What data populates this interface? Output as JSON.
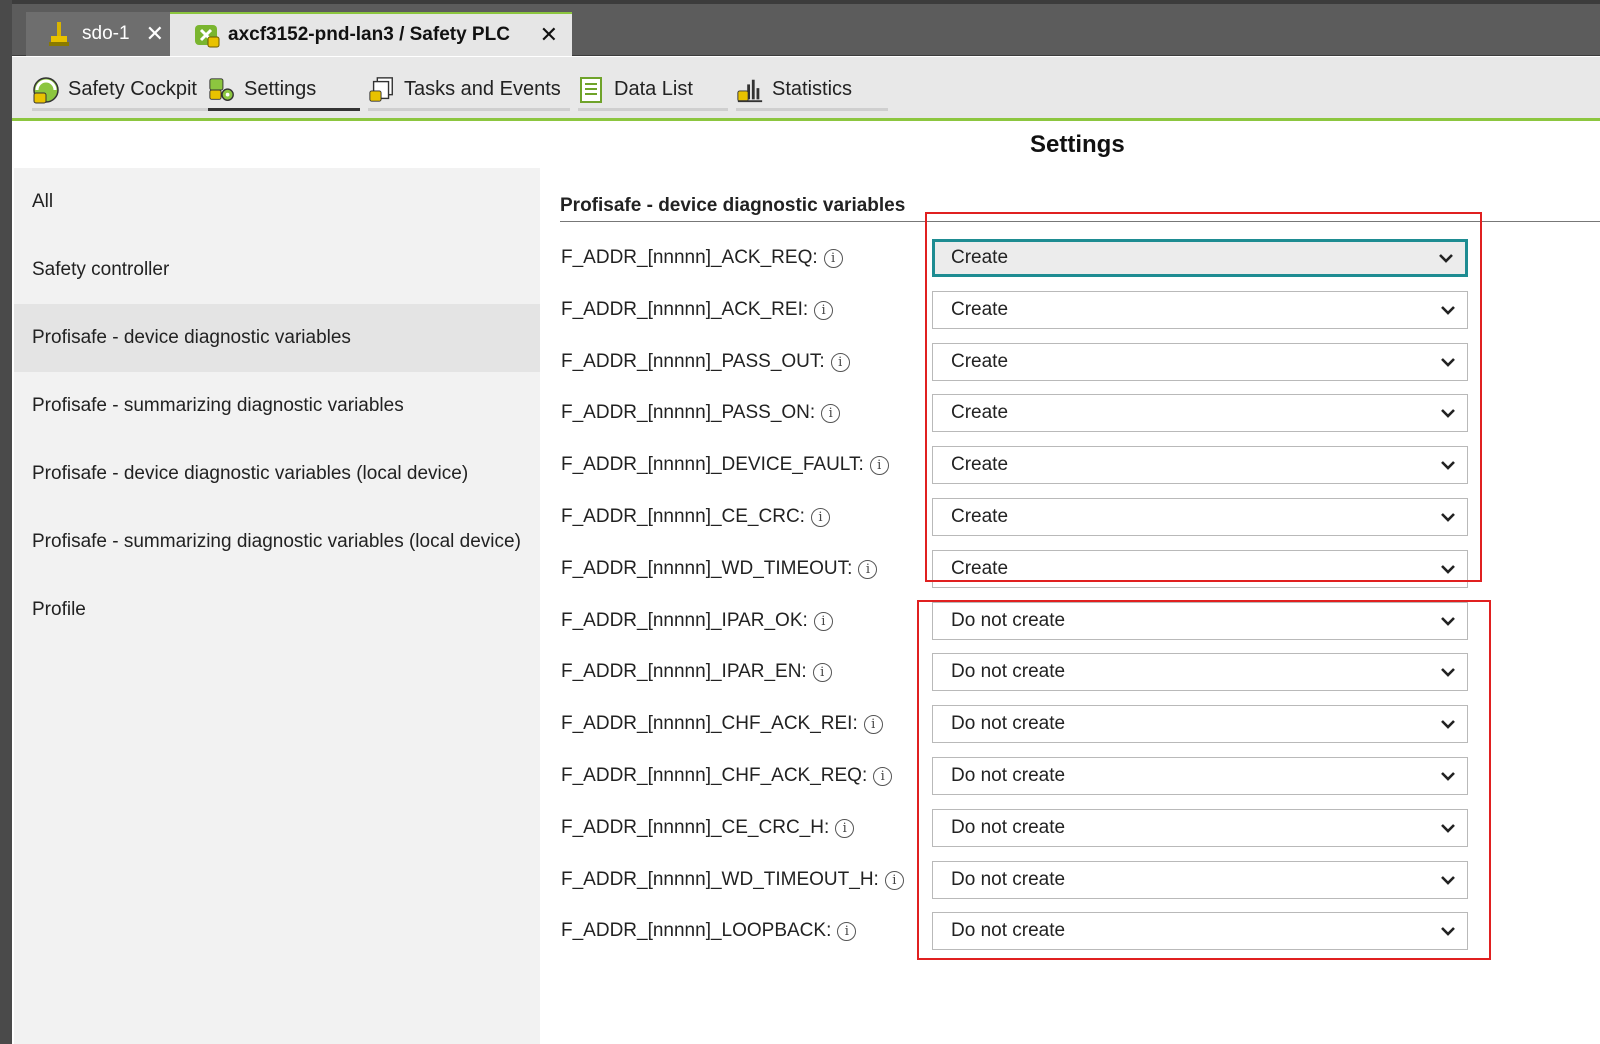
{
  "document_tabs": [
    {
      "label": "sdo-1",
      "icon": "sdo-device-icon",
      "close": "✕"
    },
    {
      "label": "axcf3152-pnd-lan3 / Safety PLC",
      "icon": "safety-plc-icon",
      "close": "✕"
    }
  ],
  "editor_tabs": [
    {
      "label": "Safety Cockpit",
      "icon": "cockpit-icon"
    },
    {
      "label": "Settings",
      "icon": "settings-gear-icon",
      "selected": true
    },
    {
      "label": "Tasks and Events",
      "icon": "tasks-icon"
    },
    {
      "label": "Data List",
      "icon": "list-icon"
    },
    {
      "label": "Statistics",
      "icon": "bar-chart-icon"
    }
  ],
  "page_title": "Settings",
  "sidebar": {
    "items": [
      {
        "label": "All"
      },
      {
        "label": "Safety controller"
      },
      {
        "label": "Profisafe - device diagnostic variables",
        "selected": true
      },
      {
        "label": "Profisafe - summarizing diagnostic variables"
      },
      {
        "label": "Profisafe - device diagnostic variables (local device)"
      },
      {
        "label": "Profisafe - summarizing diagnostic variables (local device)"
      },
      {
        "label": "Profile"
      }
    ]
  },
  "section": {
    "title": "Profisafe - device diagnostic variables",
    "info_glyph": "i",
    "rows": [
      {
        "label": "F_ADDR_[nnnnn]_ACK_REQ:",
        "value": "Create",
        "focused": true
      },
      {
        "label": "F_ADDR_[nnnnn]_ACK_REI:",
        "value": "Create"
      },
      {
        "label": "F_ADDR_[nnnnn]_PASS_OUT:",
        "value": "Create"
      },
      {
        "label": "F_ADDR_[nnnnn]_PASS_ON:",
        "value": "Create"
      },
      {
        "label": "F_ADDR_[nnnnn]_DEVICE_FAULT:",
        "value": "Create"
      },
      {
        "label": "F_ADDR_[nnnnn]_CE_CRC:",
        "value": "Create"
      },
      {
        "label": "F_ADDR_[nnnnn]_WD_TIMEOUT:",
        "value": "Create"
      },
      {
        "label": "F_ADDR_[nnnnn]_IPAR_OK:",
        "value": "Do not create"
      },
      {
        "label": "F_ADDR_[nnnnn]_IPAR_EN:",
        "value": "Do not create"
      },
      {
        "label": "F_ADDR_[nnnnn]_CHF_ACK_REI:",
        "value": "Do not create"
      },
      {
        "label": "F_ADDR_[nnnnn]_CHF_ACK_REQ:",
        "value": "Do not create"
      },
      {
        "label": "F_ADDR_[nnnnn]_CE_CRC_H:",
        "value": "Do not create"
      },
      {
        "label": "F_ADDR_[nnnnn]_WD_TIMEOUT_H:",
        "value": "Do not create"
      },
      {
        "label": "F_ADDR_[nnnnn]_LOOPBACK:",
        "value": "Do not create"
      }
    ]
  },
  "colors": {
    "accent_green": "#8cc63f",
    "focus_teal": "#1e8c92",
    "highlight_red": "#e02020"
  }
}
